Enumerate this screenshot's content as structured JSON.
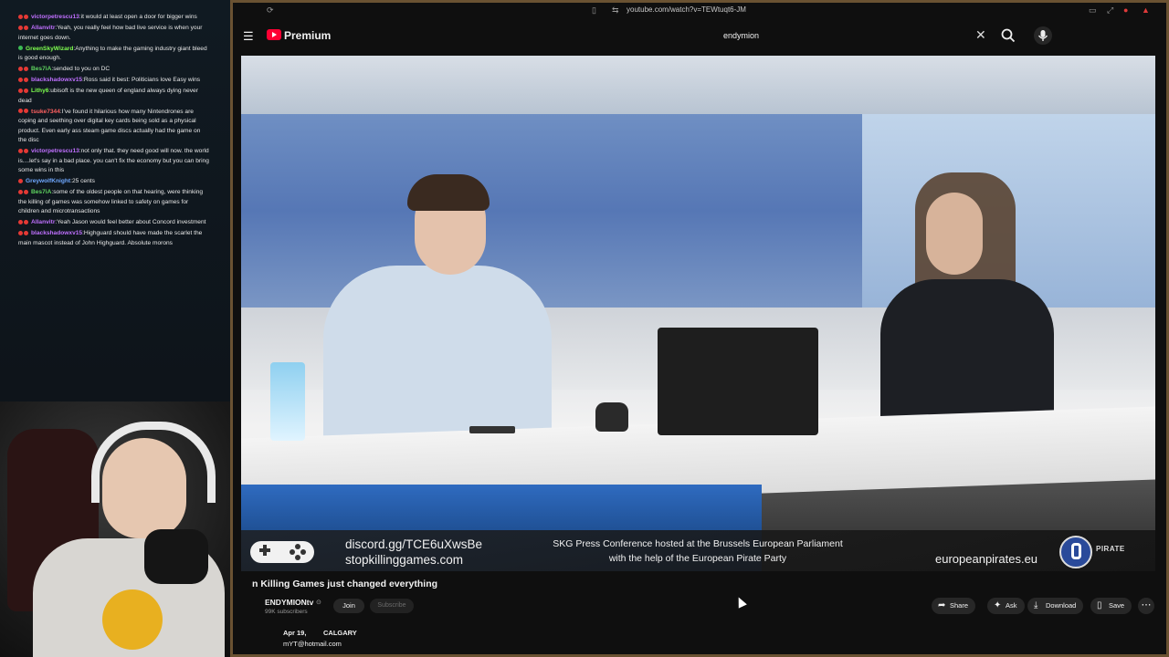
{
  "chat": {
    "messages": [
      {
        "user": "victorpetrescu13",
        "user_color": "#c070ff",
        "badges": [
          "#e53935",
          "#e53935"
        ],
        "text": "it would at least open a door for bigger wins"
      },
      {
        "user": "Allanvitr",
        "user_color": "#c070ff",
        "badges": [
          "#e53935",
          "#e53935"
        ],
        "text": "Yeah, you really feel how bad live service is when your internet goes down."
      },
      {
        "user": "GreenSkyWizard",
        "user_color": "#7fff4f",
        "badges": [
          "#3cba54"
        ],
        "text": "Anything to make the gaming industry giant bleed is good enough."
      },
      {
        "user": "Bes7iA",
        "user_color": "#5fd35f",
        "badges": [
          "#e53935",
          "#e53935"
        ],
        "text": "sended to you on DC"
      },
      {
        "user": "blackshadowxv15",
        "user_color": "#c070ff",
        "badges": [
          "#e53935",
          "#e53935"
        ],
        "text": "Ross said it best: Politicians love Easy wins"
      },
      {
        "user": "Lithy6",
        "user_color": "#7fff4f",
        "badges": [
          "#e53935",
          "#e53935"
        ],
        "text": "ubisoft is the new queen of england always dying never dead"
      },
      {
        "user": "tsuke7344",
        "user_color": "#ff6060",
        "badges": [
          "#e53935",
          "#e53935"
        ],
        "text": "I've found it hilarious how many Nintendrones are coping and seething over digital key cards being sold as a physical product. Even early ass steam game discs actually had the game on the disc"
      },
      {
        "user": "victorpetrescu13",
        "user_color": "#c070ff",
        "badges": [
          "#e53935",
          "#e53935"
        ],
        "text": "not only that. they need good will now. the world is....let's say in a bad place. you can't fix the economy but you can bring some wins in this"
      },
      {
        "user": "GreywolfKnight",
        "user_color": "#6fa8ff",
        "badges": [
          "#e53935"
        ],
        "text": "25 cents"
      },
      {
        "user": "Bes7iA",
        "user_color": "#5fd35f",
        "badges": [
          "#e53935",
          "#e53935"
        ],
        "text": "some of the oldest people on that hearing, were thinking the killing of games was somehow linked to safety on games for children and microtransactions"
      },
      {
        "user": "Allanvitr",
        "user_color": "#c070ff",
        "badges": [
          "#e53935",
          "#e53935"
        ],
        "text": "Yeah Jason would feel better about Concord investment"
      },
      {
        "user": "blackshadowxv15",
        "user_color": "#c070ff",
        "badges": [
          "#e53935",
          "#e53935"
        ],
        "text": "Highguard should have made the scarlet the main mascot instead of John Highguard. Absolute morons"
      }
    ]
  },
  "browser": {
    "url": "youtube.com/watch?v=TEWtuqt6-JM"
  },
  "header": {
    "brand": "Premium",
    "search_value": "endymion",
    "search_placeholder": "Search"
  },
  "video": {
    "overlay": {
      "discord": "discord.gg/TCE6uXwsBe",
      "site": "stopkillinggames.com",
      "caption_line1": "SKG Press Conference hosted at the Brussels European Parliament",
      "caption_line2": "with the help of the European Pirate Party",
      "pirates_url": "europeanpirates.eu",
      "pirate_logo_text": "PIRATE"
    },
    "title": "n Killing Games just changed everything",
    "channel": "ENDYMIONtv",
    "subscribers": "99K subscribers",
    "join_label": "Join",
    "subscribe_label": "Subscribe",
    "actions": {
      "share": "Share",
      "ask": "Ask",
      "download": "Download",
      "save": "Save",
      "more": "⋯"
    },
    "description": {
      "date": "Apr 19,",
      "location": "CALGARY",
      "email": "mYT@hotmail.com"
    }
  },
  "icons": {
    "menu": "hamburger-menu-icon",
    "clear": "close-icon",
    "search": "search-icon",
    "mic": "microphone-icon"
  }
}
